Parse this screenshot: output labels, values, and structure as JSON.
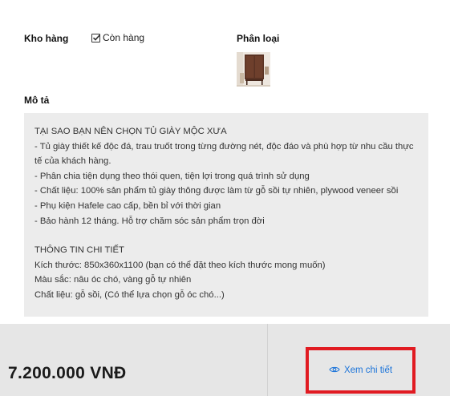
{
  "stock": {
    "label": "Kho hàng",
    "value": "Còn hàng"
  },
  "category": {
    "label": "Phân loại"
  },
  "description": {
    "label": "Mô tả",
    "lines": [
      "TẠI SAO BẠN NÊN CHỌN TỦ GIÀY MỘC XƯA",
      "- Tủ giày thiết kế độc đá, trau truốt trong từng đường nét, độc đáo và phù hợp từ nhu cầu thực tế của khách hàng.",
      "- Phân chia tiện dụng theo thói quen, tiện lợi trong quá trình sử dụng",
      "- Chất liệu: 100% sản phẩm tủ giày thông được làm từ gỗ sồi tự nhiên, plywood veneer sồi",
      "- Phụ kiện Hafele cao cấp, bền bỉ với thời gian",
      "- Bảo hành 12 tháng. Hỗ trợ chăm sóc sản phẩm trọn đời",
      "THÔNG TIN CHI TIẾT",
      "Kích thước: 850x360x1100 (bạn có thể đặt theo kích thước mong muốn)",
      "Màu sắc: nâu óc chó, vàng gỗ tự nhiên",
      "Chất liệu: gỗ sồi, (Có thể lựa chọn gỗ óc chó...)"
    ]
  },
  "footer": {
    "price": "7.200.000 VNĐ",
    "detail_button": "Xem chi tiết",
    "highlight_color": "#e11b22",
    "link_color": "#1a73d9"
  }
}
